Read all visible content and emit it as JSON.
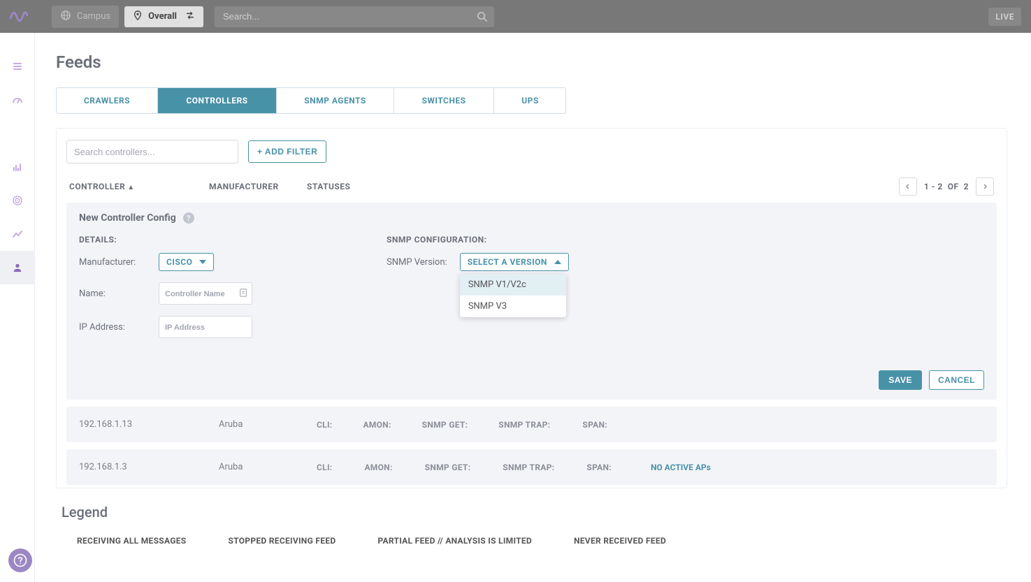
{
  "topbar": {
    "campus_label": "Campus",
    "overall_label": "Overall",
    "search_placeholder": "Search...",
    "live_label": "LIVE"
  },
  "page": {
    "title": "Feeds"
  },
  "tabs": [
    "CRAWLERS",
    "CONTROLLERS",
    "SNMP AGENTS",
    "SWITCHES",
    "UPS"
  ],
  "panel": {
    "search_placeholder": "Search controllers...",
    "add_filter_label": "+ ADD FILTER",
    "columns": {
      "controller": "CONTROLLER",
      "manufacturer": "MANUFACTURER",
      "statuses": "STATUSES"
    },
    "pagination": {
      "range": "1 - 2",
      "of": "OF",
      "total": "2"
    }
  },
  "config": {
    "title": "New Controller Config",
    "details_label": "DETAILS:",
    "snmp_label": "SNMP CONFIGURATION:",
    "manufacturer_label": "Manufacturer:",
    "manufacturer_value": "CISCO",
    "name_label": "Name:",
    "name_placeholder": "Controller Name",
    "ip_label": "IP Address:",
    "ip_placeholder": "IP Address",
    "snmp_version_label": "SNMP Version:",
    "snmp_select_label": "SELECT A VERSION",
    "snmp_options": [
      "SNMP V1/V2c",
      "SNMP V3"
    ],
    "save_label": "SAVE",
    "cancel_label": "CANCEL"
  },
  "status_labels": {
    "cli": "CLI:",
    "amon": "AMON:",
    "get": "SNMP GET:",
    "trap": "SNMP TRAP:",
    "span": "SPAN:"
  },
  "rows": [
    {
      "controller": "192.168.1.13",
      "manufacturer": "Aruba",
      "statuses": {
        "cli": "ok",
        "amon": "ok",
        "get": "ok",
        "trap": "warn",
        "span": "ok"
      },
      "extra": ""
    },
    {
      "controller": "192.168.1.3",
      "manufacturer": "Aruba",
      "statuses": {
        "cli": "err",
        "amon": "err",
        "get": "err",
        "trap": "none",
        "span": "err"
      },
      "extra": "NO ACTIVE APs"
    }
  ],
  "legend": {
    "title": "Legend",
    "items": [
      {
        "icon": "ok",
        "label": "RECEIVING ALL MESSAGES"
      },
      {
        "icon": "err",
        "label": "STOPPED RECEIVING FEED"
      },
      {
        "icon": "warn",
        "label": "PARTIAL FEED // ANALYSIS IS LIMITED"
      },
      {
        "icon": "none",
        "label": "NEVER RECEIVED FEED"
      }
    ]
  }
}
